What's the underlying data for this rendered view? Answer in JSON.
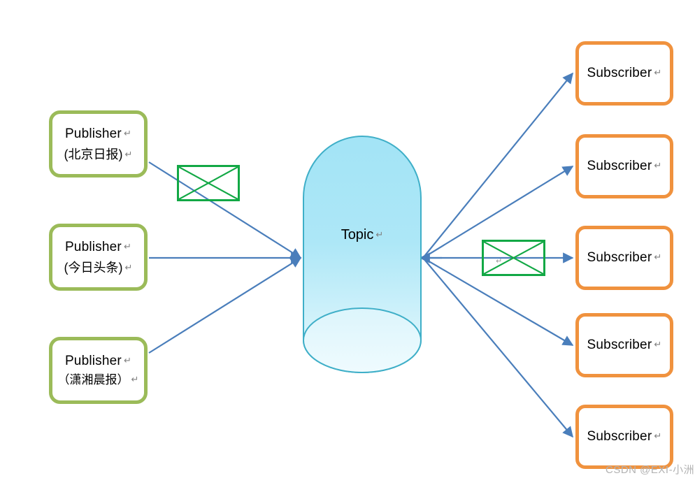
{
  "diagram": {
    "title": "Publish-Subscribe Topic Diagram",
    "colors": {
      "publisher_border": "#9BBB59",
      "subscriber_border": "#F0923E",
      "topic_fill_top": "#A5E6F7",
      "topic_fill_bottom": "#E9F9FD",
      "topic_stroke": "#3FAFC8",
      "edge": "#4A7EBB",
      "message_stroke": "#12A845",
      "watermark": "#b3b3b3",
      "background": "#FFFFFF"
    },
    "publishers": [
      {
        "name": "Publisher",
        "source": "(北京日报)",
        "mark": "↵"
      },
      {
        "name": "Publisher",
        "source": "(今日头条)",
        "mark": "↵"
      },
      {
        "name": "Publisher",
        "source": "（潇湘晨报）",
        "mark": "↵"
      }
    ],
    "topic": {
      "label": "Topic",
      "mark": "↵",
      "shape": "cylinder"
    },
    "subscribers": [
      {
        "name": "Subscriber",
        "mark": "↵"
      },
      {
        "name": "Subscriber",
        "mark": "↵"
      },
      {
        "name": "Subscriber",
        "mark": "↵"
      },
      {
        "name": "Subscriber",
        "mark": "↵"
      },
      {
        "name": "Subscriber",
        "mark": "↵"
      }
    ],
    "messages": [
      {
        "id": "message-publish",
        "mark": ""
      },
      {
        "id": "message-deliver",
        "mark": "↵"
      }
    ],
    "watermark": "CSDN @EXI-小洲"
  }
}
